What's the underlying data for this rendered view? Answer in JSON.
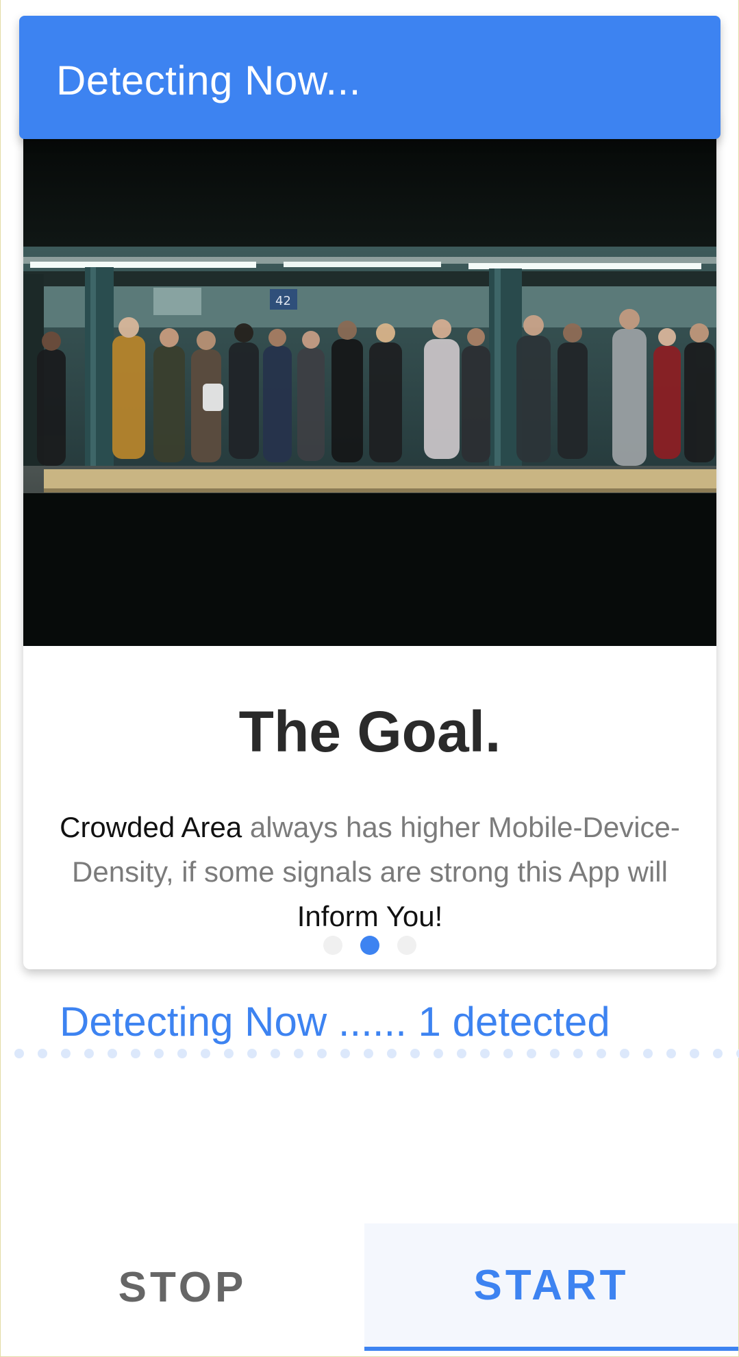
{
  "app_bar": {
    "title": "Detecting Now..."
  },
  "card": {
    "image_label": "42",
    "title": "The Goal.",
    "body": {
      "part1": "Crowded Area",
      "part2": " always has higher Mobile-Device-Density, if some signals are strong this App will ",
      "part3": "Inform You!"
    },
    "pager": {
      "total": 3,
      "active_index": 1
    }
  },
  "status": {
    "text": "Detecting Now ...... 1 detected"
  },
  "bottom_bar": {
    "stop_label": "STOP",
    "start_label": "START",
    "selected": "start"
  },
  "colors": {
    "accent": "#3d83f1",
    "app_bar": "#3d83f1",
    "status_text": "#3d83f1",
    "body_text": "#7b7b7b",
    "title_text": "#2a2a2a"
  }
}
